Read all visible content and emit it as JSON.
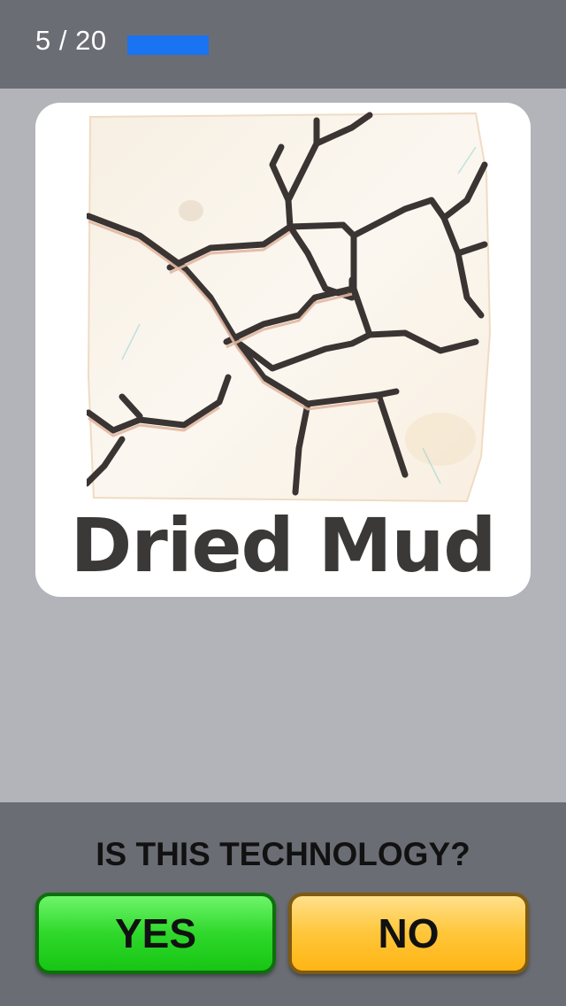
{
  "progress": {
    "text": "5 / 20",
    "current": 5,
    "total": 20,
    "fill_fraction": 0.25,
    "color": "#1a73f0"
  },
  "card": {
    "title": "Dried Mud",
    "image": "cracked-dried-mud-illustration"
  },
  "question": {
    "text": "IS THIS TECHNOLOGY?"
  },
  "buttons": {
    "yes_label": "YES",
    "no_label": "NO",
    "yes_color": "#2fd82b",
    "no_color": "#ffc63a"
  }
}
